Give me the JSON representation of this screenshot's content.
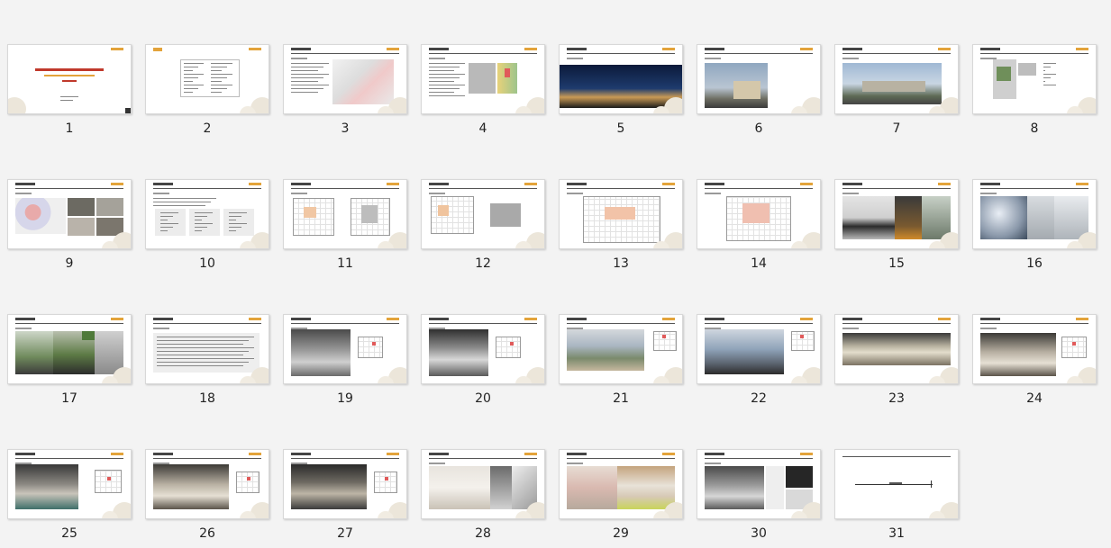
{
  "slides": [
    {
      "number": "1"
    },
    {
      "number": "2"
    },
    {
      "number": "3"
    },
    {
      "number": "4"
    },
    {
      "number": "5"
    },
    {
      "number": "6"
    },
    {
      "number": "7"
    },
    {
      "number": "8"
    },
    {
      "number": "9"
    },
    {
      "number": "10"
    },
    {
      "number": "11"
    },
    {
      "number": "12"
    },
    {
      "number": "13"
    },
    {
      "number": "14"
    },
    {
      "number": "15"
    },
    {
      "number": "16"
    },
    {
      "number": "17"
    },
    {
      "number": "18"
    },
    {
      "number": "19"
    },
    {
      "number": "20"
    },
    {
      "number": "21"
    },
    {
      "number": "22"
    },
    {
      "number": "23"
    },
    {
      "number": "24"
    },
    {
      "number": "25"
    },
    {
      "number": "26"
    },
    {
      "number": "27"
    },
    {
      "number": "28"
    },
    {
      "number": "29"
    },
    {
      "number": "30"
    },
    {
      "number": "31"
    }
  ],
  "colors": {
    "background": "#f3f3f3",
    "accent_orange": "#e3a33a",
    "title_red": "#c0392b",
    "header_line": "#555555"
  }
}
